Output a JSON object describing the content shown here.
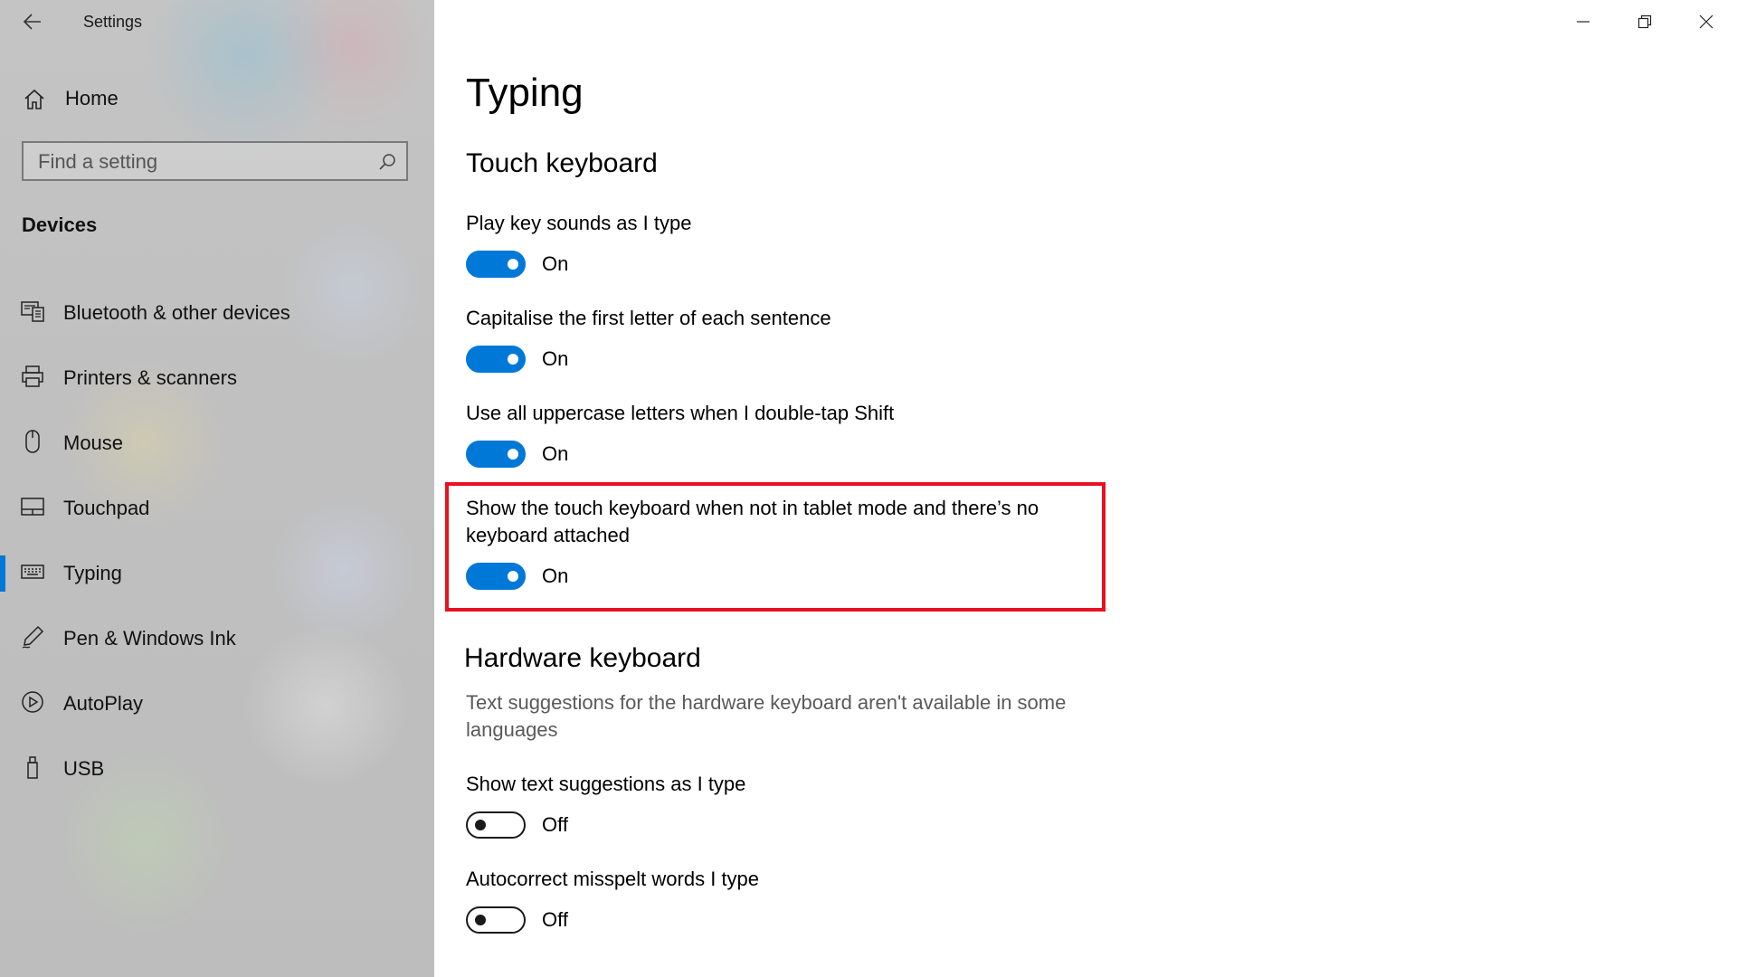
{
  "window": {
    "app_title": "Settings",
    "controls": {
      "minimize": "minimize-icon",
      "maximize": "restore-icon",
      "close": "close-icon"
    }
  },
  "sidebar": {
    "home_label": "Home",
    "search_placeholder": "Find a setting",
    "section_title": "Devices",
    "items": [
      {
        "label": "Bluetooth & other devices",
        "icon": "bluetooth-devices-icon",
        "selected": false
      },
      {
        "label": "Printers & scanners",
        "icon": "printer-icon",
        "selected": false
      },
      {
        "label": "Mouse",
        "icon": "mouse-icon",
        "selected": false
      },
      {
        "label": "Touchpad",
        "icon": "touchpad-icon",
        "selected": false
      },
      {
        "label": "Typing",
        "icon": "keyboard-icon",
        "selected": true
      },
      {
        "label": "Pen & Windows Ink",
        "icon": "pen-icon",
        "selected": false
      },
      {
        "label": "AutoPlay",
        "icon": "autoplay-icon",
        "selected": false
      },
      {
        "label": "USB",
        "icon": "usb-icon",
        "selected": false
      }
    ]
  },
  "main": {
    "title": "Typing",
    "touch_keyboard": {
      "heading": "Touch keyboard",
      "settings": [
        {
          "label": "Play key sounds as I type",
          "state": "On"
        },
        {
          "label": "Capitalise the first letter of each sentence",
          "state": "On"
        },
        {
          "label": "Use all uppercase letters when I double-tap Shift",
          "state": "On"
        },
        {
          "label": "Show the touch keyboard when not in tablet mode and there’s no keyboard attached",
          "state": "On"
        }
      ]
    },
    "hardware_keyboard": {
      "heading": "Hardware keyboard",
      "note": "Text suggestions for the hardware keyboard aren't available in some languages",
      "settings": [
        {
          "label": "Show text suggestions as I type",
          "state": "Off"
        },
        {
          "label": "Autocorrect misspelt words I type",
          "state": "Off"
        }
      ]
    }
  },
  "colors": {
    "accent": "#0078d7",
    "highlight": "#e81123"
  }
}
